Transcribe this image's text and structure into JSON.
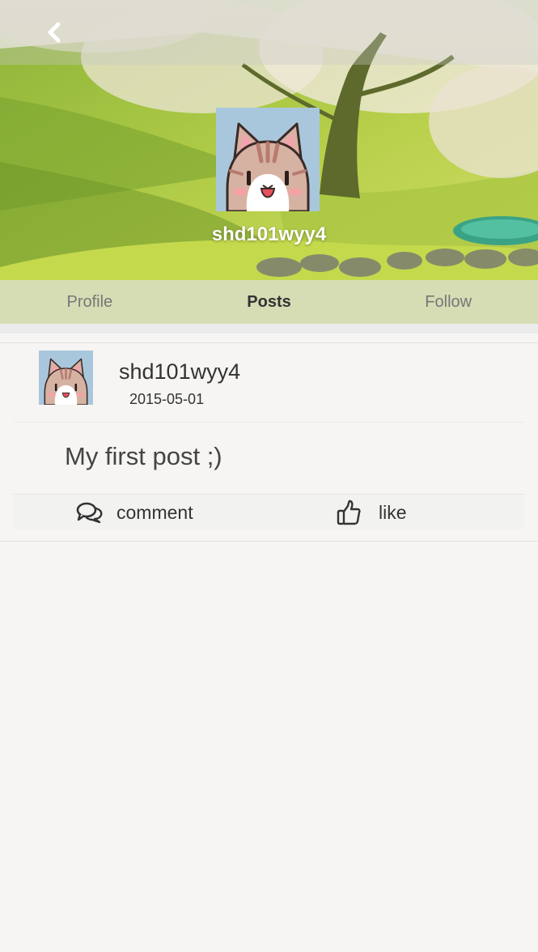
{
  "header": {
    "back_icon": "chevron-left-icon",
    "username": "shd101wyy4"
  },
  "tabs": [
    {
      "label": "Profile",
      "active": false
    },
    {
      "label": "Posts",
      "active": true
    },
    {
      "label": "Follow",
      "active": false
    }
  ],
  "post": {
    "author": "shd101wyy4",
    "date": "2015-05-01",
    "content": "My first post ;)",
    "actions": {
      "comment_label": "comment",
      "comment_icon": "comments-icon",
      "like_label": "like",
      "like_icon": "thumbs-up-icon"
    }
  },
  "colors": {
    "page_background": "#f6f5f3",
    "avatar_background": "#a9c7dc",
    "active_tab_text": "#333333",
    "inactive_tab_text": "#777777"
  }
}
